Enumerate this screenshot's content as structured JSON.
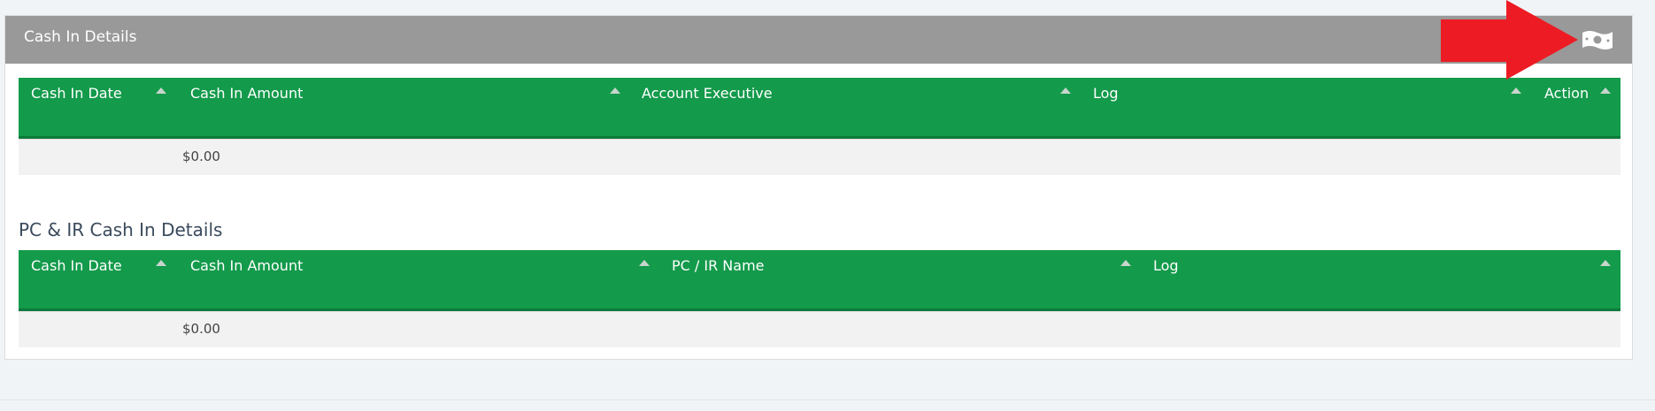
{
  "panel": {
    "title": "Cash In Details",
    "icon": "money-bill-icon"
  },
  "cash_in_table": {
    "columns": [
      "Cash In Date",
      "Cash In Amount",
      "Account Executive",
      "Log",
      "Action"
    ],
    "rows": [
      {
        "date": "",
        "amount": "$0.00",
        "account_executive": "",
        "log": "",
        "action": ""
      }
    ]
  },
  "pc_ir_section": {
    "title": "PC & IR Cash In Details",
    "columns": [
      "Cash In Date",
      "Cash In Amount",
      "PC / IR Name",
      "Log"
    ],
    "rows": [
      {
        "date": "",
        "amount": "$0.00",
        "name": "",
        "log": ""
      }
    ]
  },
  "colors": {
    "header_gray": "#999999",
    "table_green": "#139a4b",
    "arrow_red": "#ed1c24"
  }
}
